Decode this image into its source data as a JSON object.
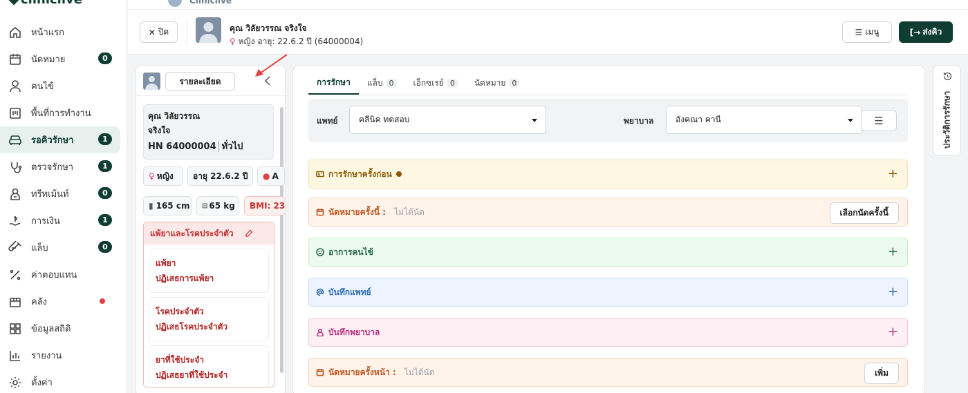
{
  "app": {
    "logo": "cliniclive",
    "clinic_name": "Cliniclive"
  },
  "sidebar": {
    "items": [
      {
        "label": "หน้าแรก",
        "icon": "home-icon",
        "badge": null
      },
      {
        "label": "นัดหมาย",
        "icon": "calendar-icon",
        "badge": "0"
      },
      {
        "label": "คนไข้",
        "icon": "user-icon",
        "badge": null
      },
      {
        "label": "พื้นที่การทำงาน",
        "icon": "workspace-icon",
        "badge": null
      },
      {
        "label": "รอคิวรักษา",
        "icon": "sofa-icon",
        "badge": "1",
        "active": true
      },
      {
        "label": "ตรวจรักษา",
        "icon": "stethoscope-icon",
        "badge": "1"
      },
      {
        "label": "ทรีทเม้นท์",
        "icon": "doctor-icon",
        "badge": "0"
      },
      {
        "label": "การเงิน",
        "icon": "payment-icon",
        "badge": "1"
      },
      {
        "label": "แล็บ",
        "icon": "test-tube-icon",
        "badge": "0"
      },
      {
        "label": "ค่าตอบแทน",
        "icon": "percent-icon",
        "badge": null
      },
      {
        "label": "คลัง",
        "icon": "package-icon",
        "dot": true
      },
      {
        "label": "ข้อมูลสถิติ",
        "icon": "grid-icon",
        "badge": null
      },
      {
        "label": "รายงาน",
        "icon": "bar-chart-icon",
        "badge": null
      },
      {
        "label": "ตั้งค่า",
        "icon": "gear-icon",
        "badge": null
      }
    ]
  },
  "header": {
    "close_label": "ปิด",
    "patient_name": "คุณ วิลัยวรรณ จริงใจ",
    "gender": "หญิง",
    "age_text": "อายุ: 22.6.2 ปี",
    "hn_paren": "(64000004)",
    "menu_label": "เมนู",
    "send_queue_label": "ส่งคิว"
  },
  "patient_panel": {
    "detail_button": "รายละเอียด",
    "name_line1": "คุณ วิลัยวรรณ",
    "name_line2": "จริงใจ",
    "hn": "HN 64000004",
    "patient_type": "ทั่วไป",
    "gender_chip": "หญิง",
    "age_chip": "อายุ 22.6.2 ปี",
    "blood_chip": "A",
    "height_chip": "165 cm",
    "weight_chip": "65 kg",
    "bmi_chip": "BMI: 23",
    "allergy_title": "แพ้ยาและโรคประจำตัว",
    "allergy_items": [
      {
        "title": "แพ้ยา",
        "value": "ปฏิเสธการแพ้ยา"
      },
      {
        "title": "โรคประจำตัว",
        "value": "ปฏิเสธโรคประจำตัว"
      },
      {
        "title": "ยาที่ใช้ประจำ",
        "value": "ปฏิเสธยาที่ใช้ประจำ"
      }
    ]
  },
  "main": {
    "tabs": [
      {
        "label": "การรักษา",
        "count": null,
        "active": true
      },
      {
        "label": "แล็บ",
        "count": "0"
      },
      {
        "label": "เอ็กซเรย์",
        "count": "0"
      },
      {
        "label": "นัดหมาย",
        "count": "0"
      }
    ],
    "doctor_label": "แพทย์",
    "doctor_value": "คลีนิค ทดสอบ",
    "nurse_label": "พยาบาล",
    "nurse_value": "อังคณา คานี",
    "sections": {
      "prev_treatment": "การรักษาครั้งก่อน",
      "appt_this": "นัดหมายครั้งนี้ :",
      "appt_this_value": "ไม่ได้นัด",
      "appt_this_button": "เลือกนัดครั้งนี้",
      "symptoms": "อาการคนไข้",
      "doctor_note": "บันทึกแพทย์",
      "nurse_note": "บันทึกพยาบาล",
      "appt_next": "นัดหมายครั้งหน้า :",
      "appt_next_value": "ไม่ได้นัด",
      "appt_next_button": "เพิ่ม"
    }
  },
  "history_tab": {
    "label": "ประวัติการรักษา"
  },
  "colors": {
    "primary": "#0f3d32",
    "danger": "#e53e3e"
  }
}
